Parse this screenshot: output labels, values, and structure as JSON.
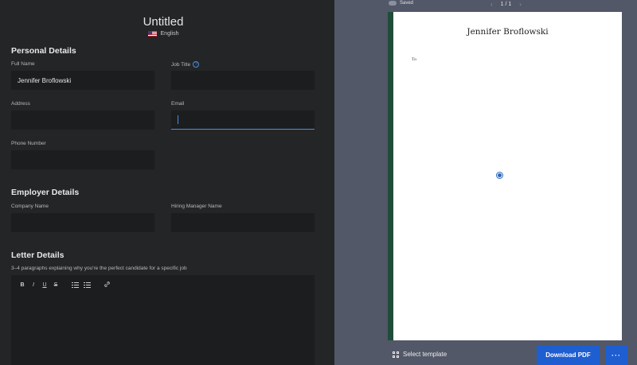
{
  "document": {
    "title": "Untitled",
    "language": "English"
  },
  "sections": {
    "personal": "Personal Details",
    "employer": "Employer Details",
    "letter": "Letter Details"
  },
  "fields": {
    "full_name": {
      "label": "Full Name",
      "value": "Jennifer Broflowski"
    },
    "job_title": {
      "label": "Job Title",
      "value": ""
    },
    "address": {
      "label": "Address",
      "value": ""
    },
    "email": {
      "label": "Email",
      "value": ""
    },
    "phone": {
      "label": "Phone Number",
      "value": ""
    },
    "company": {
      "label": "Company Name",
      "value": ""
    },
    "hiring_manager": {
      "label": "Hiring Manager Name",
      "value": ""
    }
  },
  "letter": {
    "hint": "3–4 paragraphs explaining why you're the perfect candidate for a specific job",
    "toolbar": {
      "bold": "B",
      "italic": "I",
      "underline": "U",
      "strike": "S"
    }
  },
  "preview": {
    "save_status": "Saved",
    "pager": "1 / 1",
    "page_name": "Jennifer Broflowski",
    "page_to": "To"
  },
  "footer": {
    "select_template": "Select template",
    "download": "Download PDF",
    "more": "···"
  },
  "colors": {
    "accent": "#1e5ed1",
    "template_bar": "#1f4d39"
  }
}
